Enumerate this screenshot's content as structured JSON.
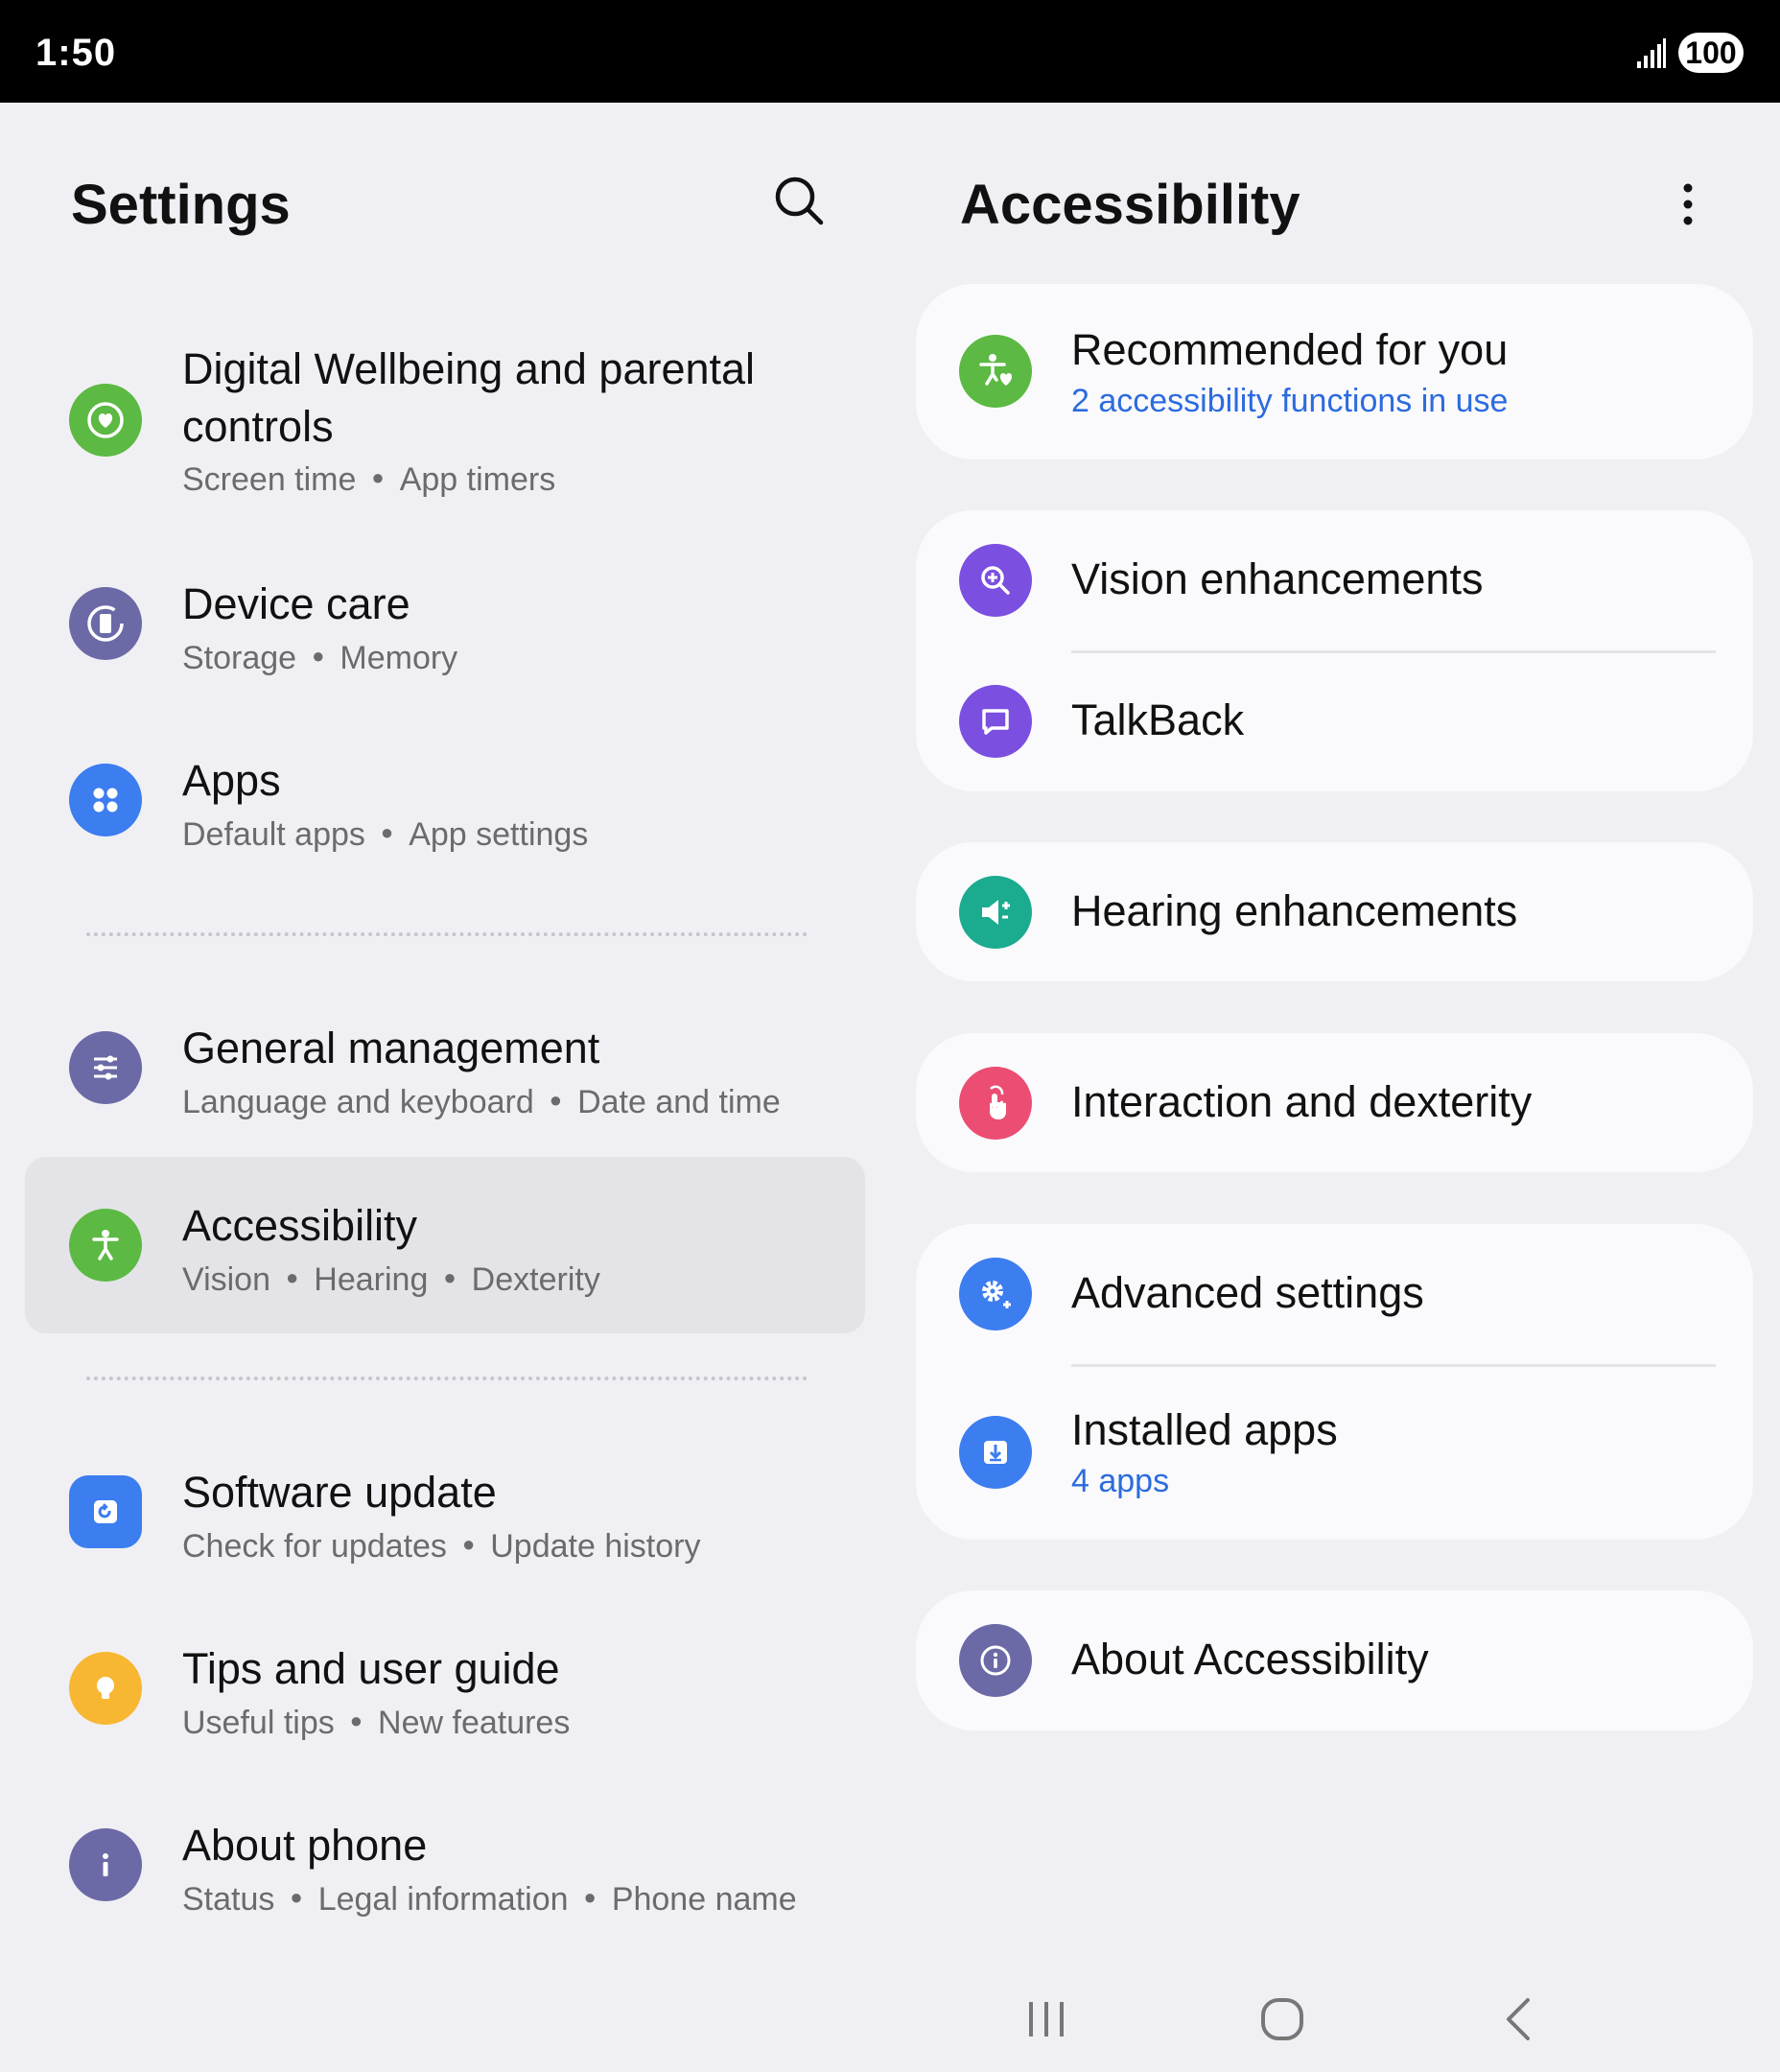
{
  "status_bar": {
    "time": "1:50",
    "battery": "100"
  },
  "settings": {
    "title": "Settings",
    "items": [
      {
        "title": "Digital Wellbeing and parental controls",
        "title_line1": "Digital Wellbeing and parental",
        "title_line2": "controls",
        "subs": [
          "Screen time",
          "App timers"
        ],
        "icon": "wellbeing-icon",
        "color": "#5cb943"
      },
      {
        "title": "Device care",
        "subs": [
          "Storage",
          "Memory"
        ],
        "icon": "device-care-icon",
        "color": "#6b69a6"
      },
      {
        "title": "Apps",
        "subs": [
          "Default apps",
          "App settings"
        ],
        "icon": "apps-icon",
        "color": "#3c7df0"
      },
      {
        "title": "General management",
        "subs": [
          "Language and keyboard",
          "Date and time"
        ],
        "icon": "general-management-icon",
        "color": "#6b69a6"
      },
      {
        "title": "Accessibility",
        "subs": [
          "Vision",
          "Hearing",
          "Dexterity"
        ],
        "icon": "accessibility-icon",
        "color": "#5cb943"
      },
      {
        "title": "Software update",
        "subs": [
          "Check for updates",
          "Update history"
        ],
        "icon": "software-update-icon",
        "color": "#3c7df0"
      },
      {
        "title": "Tips and user guide",
        "subs": [
          "Useful tips",
          "New features"
        ],
        "icon": "tips-icon",
        "color": "#f8b732"
      },
      {
        "title": "About phone",
        "subs": [
          "Status",
          "Legal information",
          "Phone name"
        ],
        "icon": "about-phone-icon",
        "color": "#6b69a6"
      }
    ]
  },
  "accessibility": {
    "title": "Accessibility",
    "recommended": {
      "title": "Recommended for you",
      "sub": "2 accessibility functions in use",
      "color": "#5cb943"
    },
    "vision": {
      "title": "Vision enhancements",
      "color": "#7b4fe0"
    },
    "talkback": {
      "title": "TalkBack",
      "color": "#7b4fe0"
    },
    "hearing": {
      "title": "Hearing enhancements",
      "color": "#1bab8f"
    },
    "interaction": {
      "title": "Interaction and dexterity",
      "color": "#ec4d72"
    },
    "advanced": {
      "title": "Advanced settings",
      "color": "#3c7df0"
    },
    "installed": {
      "title": "Installed apps",
      "sub": "4 apps",
      "color": "#3c7df0"
    },
    "about": {
      "title": "About Accessibility",
      "color": "#6b69a6"
    }
  },
  "colors": {
    "accent_link": "#2c6bde",
    "selected_row": "#e4e4e8",
    "background": "#f0f0f4",
    "card": "#fafafd"
  }
}
